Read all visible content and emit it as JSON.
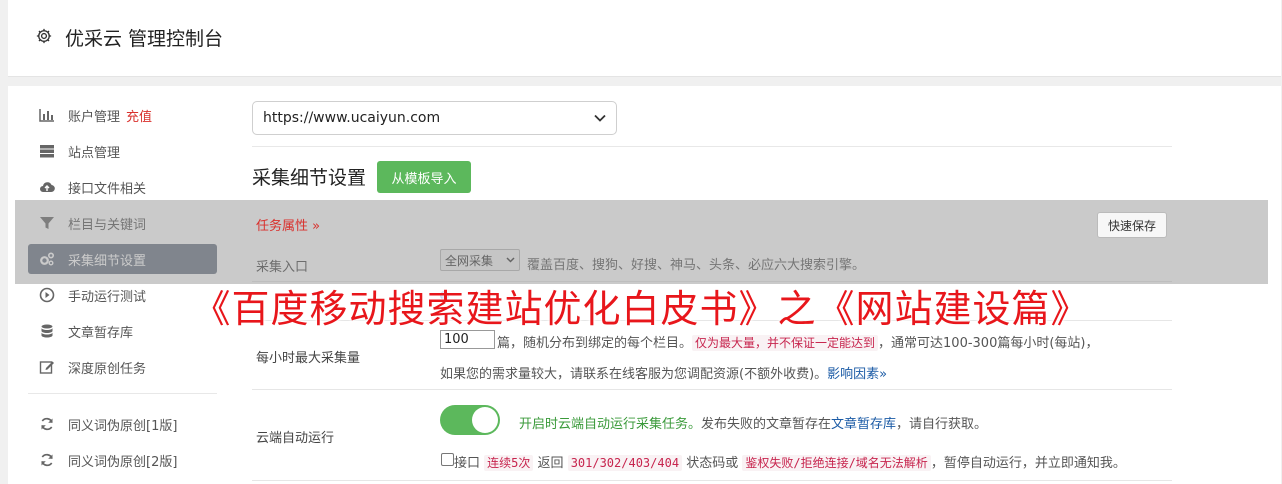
{
  "header": {
    "title": "优采云 管理控制台"
  },
  "sidebar": {
    "items": [
      {
        "label": "账户管理",
        "extra": "充值",
        "icon": "bar-chart-icon"
      },
      {
        "label": "站点管理",
        "icon": "server-icon"
      },
      {
        "label": "接口文件相关",
        "icon": "cloud-upload-icon"
      },
      {
        "label": "栏目与关键词",
        "icon": "filter-icon"
      },
      {
        "label": "采集细节设置",
        "icon": "cogs-icon",
        "active": true
      },
      {
        "label": "手动运行测试",
        "icon": "play-circle-icon"
      },
      {
        "label": "文章暂存库",
        "icon": "database-icon"
      },
      {
        "label": "深度原创任务",
        "icon": "edit-icon"
      },
      {
        "label": "同义词伪原创[1版]",
        "icon": "refresh-icon"
      },
      {
        "label": "同义词伪原创[2版]",
        "icon": "refresh-icon"
      }
    ]
  },
  "site_select": {
    "value": "https://www.ucaiyun.com"
  },
  "section": {
    "title": "采集细节设置",
    "import_button": "从模板导入"
  },
  "task_attr": {
    "label": "任务属性 »",
    "save_button": "快速保存"
  },
  "rows": {
    "entry": {
      "label": "采集入口",
      "select_value": "全网采集",
      "desc": "覆盖百度、搜狗、好搜、神马、头条、必应六大搜索引擎。"
    },
    "max_per_hour": {
      "label": "每小时最大采集量",
      "value": "100",
      "text1": "篇，随机分布到绑定的每个栏目。",
      "code1": "仅为最大量，并不保证一定能达到",
      "text2": "，通常可达100-300篇每小时(每站)，",
      "text3": "如果您的需求量较大，请联系在线客服为您调配资源(不额外收费)。",
      "link": "影响因素»"
    },
    "cloud_run": {
      "label": "云端自动运行",
      "toggle_on": true,
      "green_text": "开启时云端自动运行采集任务。",
      "text1": "发布失败的文章暂存在",
      "link": "文章暂存库",
      "text2": "，请自行获取。",
      "chk_label": "接口",
      "code1": "连续5次",
      "text3": "返回",
      "code2": "301/302/403/404",
      "text4": "状态码或",
      "code3": "鉴权失败/拒绝连接/域名无法解析",
      "text5": "，暂停自动运行，并立即通知我。"
    }
  },
  "banner": {
    "text": "《百度移动搜索建站优化白皮书》之《网站建设篇》"
  },
  "colors": {
    "accent_green": "#5cb85c",
    "sidebar_active": "#6b7584",
    "banner_red": "#e8161b"
  }
}
